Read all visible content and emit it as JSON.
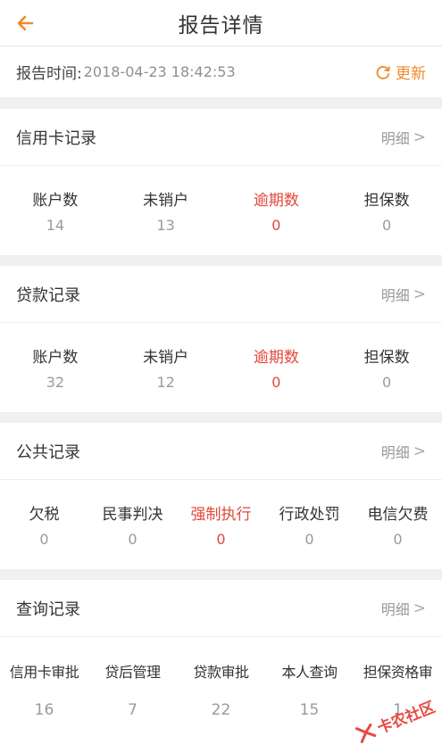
{
  "nav": {
    "title": "报告详情"
  },
  "report": {
    "time_label": "报告时间:",
    "time_value": "2018-04-23 18:42:53",
    "refresh_label": "更新"
  },
  "colors": {
    "accent": "#ef8a2e",
    "warn": "#e2473a",
    "muted": "#9a9a9a"
  },
  "detail_label": "明细",
  "credit_card": {
    "title": "信用卡记录",
    "stats": [
      {
        "label": "账户数",
        "value": "14"
      },
      {
        "label": "未销户",
        "value": "13"
      },
      {
        "label": "逾期数",
        "value": "0"
      },
      {
        "label": "担保数",
        "value": "0"
      }
    ]
  },
  "loan": {
    "title": "贷款记录",
    "stats": [
      {
        "label": "账户数",
        "value": "32"
      },
      {
        "label": "未销户",
        "value": "12"
      },
      {
        "label": "逾期数",
        "value": "0"
      },
      {
        "label": "担保数",
        "value": "0"
      }
    ]
  },
  "public": {
    "title": "公共记录",
    "stats": [
      {
        "label": "欠税",
        "value": "0"
      },
      {
        "label": "民事判决",
        "value": "0"
      },
      {
        "label": "强制执行",
        "value": "0"
      },
      {
        "label": "行政处罚",
        "value": "0"
      },
      {
        "label": "电信欠费",
        "value": "0"
      }
    ]
  },
  "query": {
    "title": "查询记录",
    "stats": [
      {
        "label": "信用卡审批",
        "value": "16"
      },
      {
        "label": "贷后管理",
        "value": "7"
      },
      {
        "label": "贷款审批",
        "value": "22"
      },
      {
        "label": "本人查询",
        "value": "15"
      },
      {
        "label": "担保资格审",
        "value": "1"
      }
    ]
  },
  "watermark": {
    "text": "卡农社区"
  }
}
